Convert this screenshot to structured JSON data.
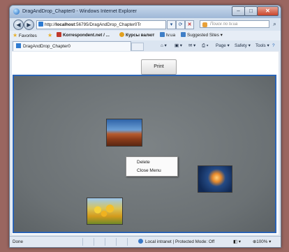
{
  "window": {
    "title": "DragAndDrop_Chapter0 - Windows Internet Explorer"
  },
  "address_bar": {
    "url_scheme": "http://",
    "url_host": "localhost",
    "url_rest": ":56795/DragAndDrop_Chapter0Tr",
    "search_placeholder": "Поиск по tv.ua"
  },
  "favorites_bar": {
    "favorites_label": "Favorites",
    "items": [
      "Korrespondent.net / ...",
      "Курсы валют",
      "tv.ua",
      "Suggested Sites"
    ]
  },
  "tab": {
    "label": "DragAndDrop_Chapter0"
  },
  "command_bar": {
    "items": [
      "Page",
      "Safety",
      "Tools"
    ]
  },
  "page": {
    "print_label": "Print",
    "context_menu": {
      "items": [
        "Delete",
        "Close Menu"
      ]
    }
  },
  "status_bar": {
    "left": "Done",
    "zone": "Local intranet | Protected Mode: Off",
    "zoom": "100%"
  },
  "colors": {
    "canvas_border": "#2a63b5",
    "canvas_bg": "#6b7174",
    "desktop": "#9a6660"
  },
  "icons": [
    "ie-icon",
    "back-icon",
    "forward-icon",
    "refresh-icon",
    "stop-icon",
    "search-icon",
    "star-icon",
    "home-icon",
    "feeds-icon",
    "mail-icon",
    "print-icon",
    "help-icon",
    "zoom-icon"
  ]
}
